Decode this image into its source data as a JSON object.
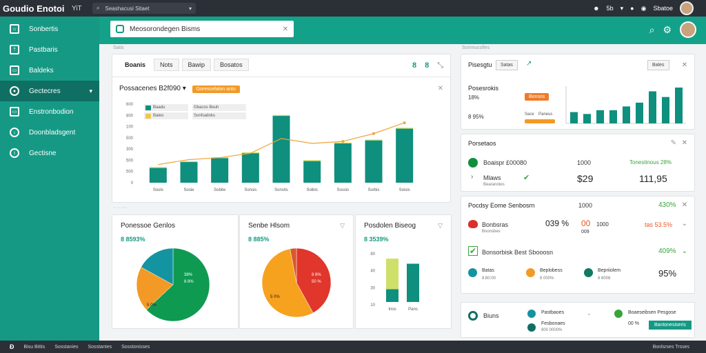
{
  "app": {
    "brand": "Goudio Enotoi",
    "brand_sub": "YiT"
  },
  "topbar": {
    "search_placeholder": "Seashacusi Sitaet",
    "user_count": "5b",
    "user_name": "Sbatoe"
  },
  "sidebar": {
    "items": [
      {
        "label": "Sonbertis"
      },
      {
        "label": "Pastbaris"
      },
      {
        "label": "Baldeks"
      },
      {
        "label": "Gectecres"
      },
      {
        "label": "Enstronbodion"
      },
      {
        "label": "Doonbladsgent"
      },
      {
        "label": "Gectisne"
      }
    ]
  },
  "header": {
    "search_value": "Meosorondegen Bisms"
  },
  "main_chart": {
    "tabs": [
      "Boanis",
      "Nots",
      "Bawip",
      "Bosatos"
    ],
    "actions": [
      "8",
      "8"
    ],
    "title": "Possacenes",
    "title_value": "B2f090",
    "badge": "Gorescefalon anto",
    "legend": [
      "Baadu",
      "Gbacos Beuh",
      "Baleo",
      "Sonfoalinks"
    ],
    "section_label": "Satis",
    "section_label2": "Sorimucolles"
  },
  "chart_data": {
    "type": "bar",
    "categories": [
      "Sools",
      "Sosie",
      "Sobite",
      "Sonsis",
      "Sonstis",
      "Soibis",
      "Sossis",
      "Sorbis",
      "Soisis"
    ],
    "values": [
      150,
      210,
      250,
      300,
      680,
      220,
      400,
      430,
      550
    ],
    "top_values": [
      160,
      220,
      260,
      310,
      690,
      230,
      410,
      440,
      560
    ],
    "line_values": [
      185,
      235,
      255,
      300,
      450,
      400,
      420,
      500,
      610
    ],
    "yticks": [
      "0",
      "500",
      "500",
      "300",
      "500",
      "100",
      "800",
      "600"
    ],
    "ylim": [
      0,
      800
    ],
    "colors": {
      "bar": "#0f8f7e",
      "top": "#d7e36a",
      "line": "#f0a43a"
    }
  },
  "pies": [
    {
      "title": "Ponessoe Genlos",
      "pct": "8 8593%",
      "labels": [
        "38%",
        "8 8%",
        "5 0%"
      ],
      "slices": [
        {
          "value": 63,
          "color": "#0f9a51"
        },
        {
          "value": 20,
          "color": "#f39a26"
        },
        {
          "value": 17,
          "color": "#1493a1"
        }
      ]
    },
    {
      "title": "Senbe Hlsom",
      "pct": "8 885%",
      "labels": [
        "8 8%",
        "50 %",
        "5 0%"
      ],
      "slices": [
        {
          "value": 42,
          "color": "#e0362b"
        },
        {
          "value": 55,
          "color": "#f6a21e"
        },
        {
          "value": 3,
          "color": "#d9582a"
        }
      ]
    },
    {
      "title": "Posdolen Biseog",
      "pct": "8 3539%",
      "ticks": [
        "80",
        "40",
        "30",
        "10"
      ],
      "cats": [
        "Inos",
        "Pans"
      ],
      "bars": [
        {
          "low": 25,
          "high": 85,
          "low_color": "#0f8f7e",
          "high_color": "#cfe06a"
        },
        {
          "low": 75,
          "high": 0,
          "low_color": "#0f8f7e",
          "high_color": "#cfe06a"
        }
      ],
      "ylim": [
        0,
        100
      ]
    }
  ],
  "right_top": {
    "title": "Pisesgtu",
    "btn": "Satas",
    "subtitle": "Posesrokis",
    "pct1": "18%",
    "pct2": "8 95%",
    "badge": "Bonsos",
    "mini_x": [
      "Sace",
      "Paneus"
    ],
    "mini_chart": {
      "values": [
        12,
        10,
        14,
        14,
        18,
        22,
        34,
        28,
        38
      ],
      "color": "#0f8f7e"
    },
    "side_btn": "Bales"
  },
  "perf": {
    "title": "Porsetaos",
    "row1_label": "Boaispr £00080",
    "row1_num": "1000",
    "row1_pct": "Tonestinous 28%",
    "row2_label": "Mlaws",
    "row2_sub": "Bearanotes",
    "row2_num": "$29",
    "row2_big": "111,95"
  },
  "summary": {
    "title": "Pocdsy Eome Senbosrn",
    "title_num": "1000",
    "title_pct": "430%",
    "row1_label": "Bonbsras",
    "row1_sub": "Boonsbes",
    "row1_val": "039 %",
    "row1_val2": "00",
    "row1_num": "1000",
    "row1_num2": "009",
    "row1_pct": "tas 53.5%",
    "row2_label": "Bonsorbisk Best Sbooosn",
    "row2_pct": "409%",
    "items": [
      {
        "label": "Batas",
        "sub": "8:80:00"
      },
      {
        "label": "Beplobess",
        "sub": "8 000%"
      },
      {
        "label": "Bepriiolem",
        "sub": "8 8008"
      }
    ],
    "big": "95%"
  },
  "bottom": {
    "label": "Biuns",
    "col2": [
      {
        "label": "Pastbaoes"
      },
      {
        "label": "Fesbonaes"
      }
    ],
    "col2_sub": "800 0000%",
    "col3_label": "Boaeseibsen Pesgose",
    "col3_val": "00 %",
    "btn": "Bantonesiseris"
  },
  "status": {
    "items": [
      "Bisu Bittis",
      "Sosstanies",
      "Sosstantes",
      "Sosstonisses"
    ],
    "right": "Bonlsrses Trsses"
  }
}
